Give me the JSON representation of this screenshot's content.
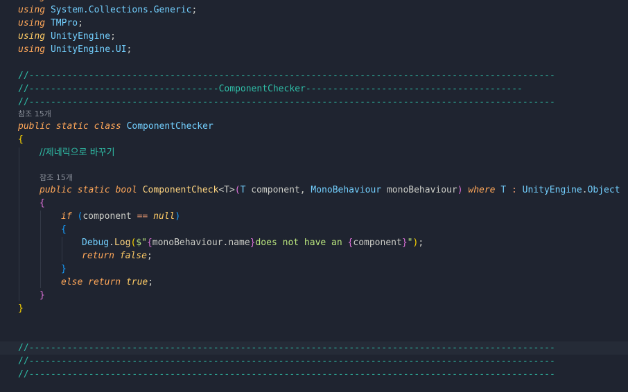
{
  "editor": {
    "colors": {
      "background": "#1f2430",
      "keyword": "#ffa759",
      "type": "#73d0ff",
      "function": "#ffd580",
      "string": "#bae67e",
      "comment": "#2fbfa8"
    },
    "lines": {
      "using_collections": {
        "kw": "using",
        "ns": "System.Collections.Generic",
        "end": ";"
      },
      "using_tmpro": {
        "kw": "using",
        "ns": "TMPro",
        "end": ";"
      },
      "using_unityengine": {
        "kw": "using",
        "ns": "UnityEngine",
        "end": ";"
      },
      "using_unityengine_ui": {
        "kw": "using",
        "ns": "UnityEngine.UI",
        "end": ";"
      },
      "divider_1": "//-------------------------------------------------------------------------------------------------",
      "divider_title": "//-----------------------------------ComponentChecker----------------------------------------",
      "divider_2": "//-------------------------------------------------------------------------------------------------",
      "codelens_class": "참조 15개",
      "class_decl": {
        "public": "public",
        "static": "static",
        "class": "class",
        "name": "ComponentChecker"
      },
      "open_brace_class": "{",
      "korean_comment": "//제네릭으로 바꾸기",
      "codelens_method": "참조 15개",
      "method_decl": {
        "public": "public",
        "static": "static",
        "bool": "bool",
        "name": "ComponentCheck",
        "generic": "<T>",
        "open_paren": "(",
        "param1_type": "T",
        "param1_name": "component",
        "comma": ",",
        "param2_type": "MonoBehaviour",
        "param2_name": "monoBehaviour",
        "close_paren": ")",
        "where": "where",
        "constraint_t": "T",
        "colon": ":",
        "constraint_ns": "UnityEngine",
        "dot": ".",
        "constraint_type": "Object"
      },
      "open_brace_method": "{",
      "if_line": {
        "if": "if",
        "open": "(",
        "var": "component",
        "op": "==",
        "null": "null",
        "close": ")"
      },
      "open_brace_if": "{",
      "debug_line": {
        "class": "Debug",
        "dot": ".",
        "method": "Log",
        "open": "(",
        "interp": "$\"",
        "brace_open_1": "{",
        "expr": "monoBehaviour.name",
        "brace_close_1": "}",
        "text": "does not have an ",
        "brace_open_2": "{",
        "expr2": "component",
        "brace_close_2": "}",
        "quote_end": "\"",
        "close": ")",
        "end": ";"
      },
      "return_false": {
        "return": "return",
        "value": "false",
        "end": ";"
      },
      "close_brace_if": "}",
      "else_line": {
        "else": "else",
        "return": "return",
        "value": "true",
        "end": ";"
      },
      "close_brace_method": "}",
      "close_brace_class": "}",
      "divider_3": "//-------------------------------------------------------------------------------------------------",
      "divider_4": "//-------------------------------------------------------------------------------------------------",
      "divider_5": "//-------------------------------------------------------------------------------------------------"
    }
  }
}
